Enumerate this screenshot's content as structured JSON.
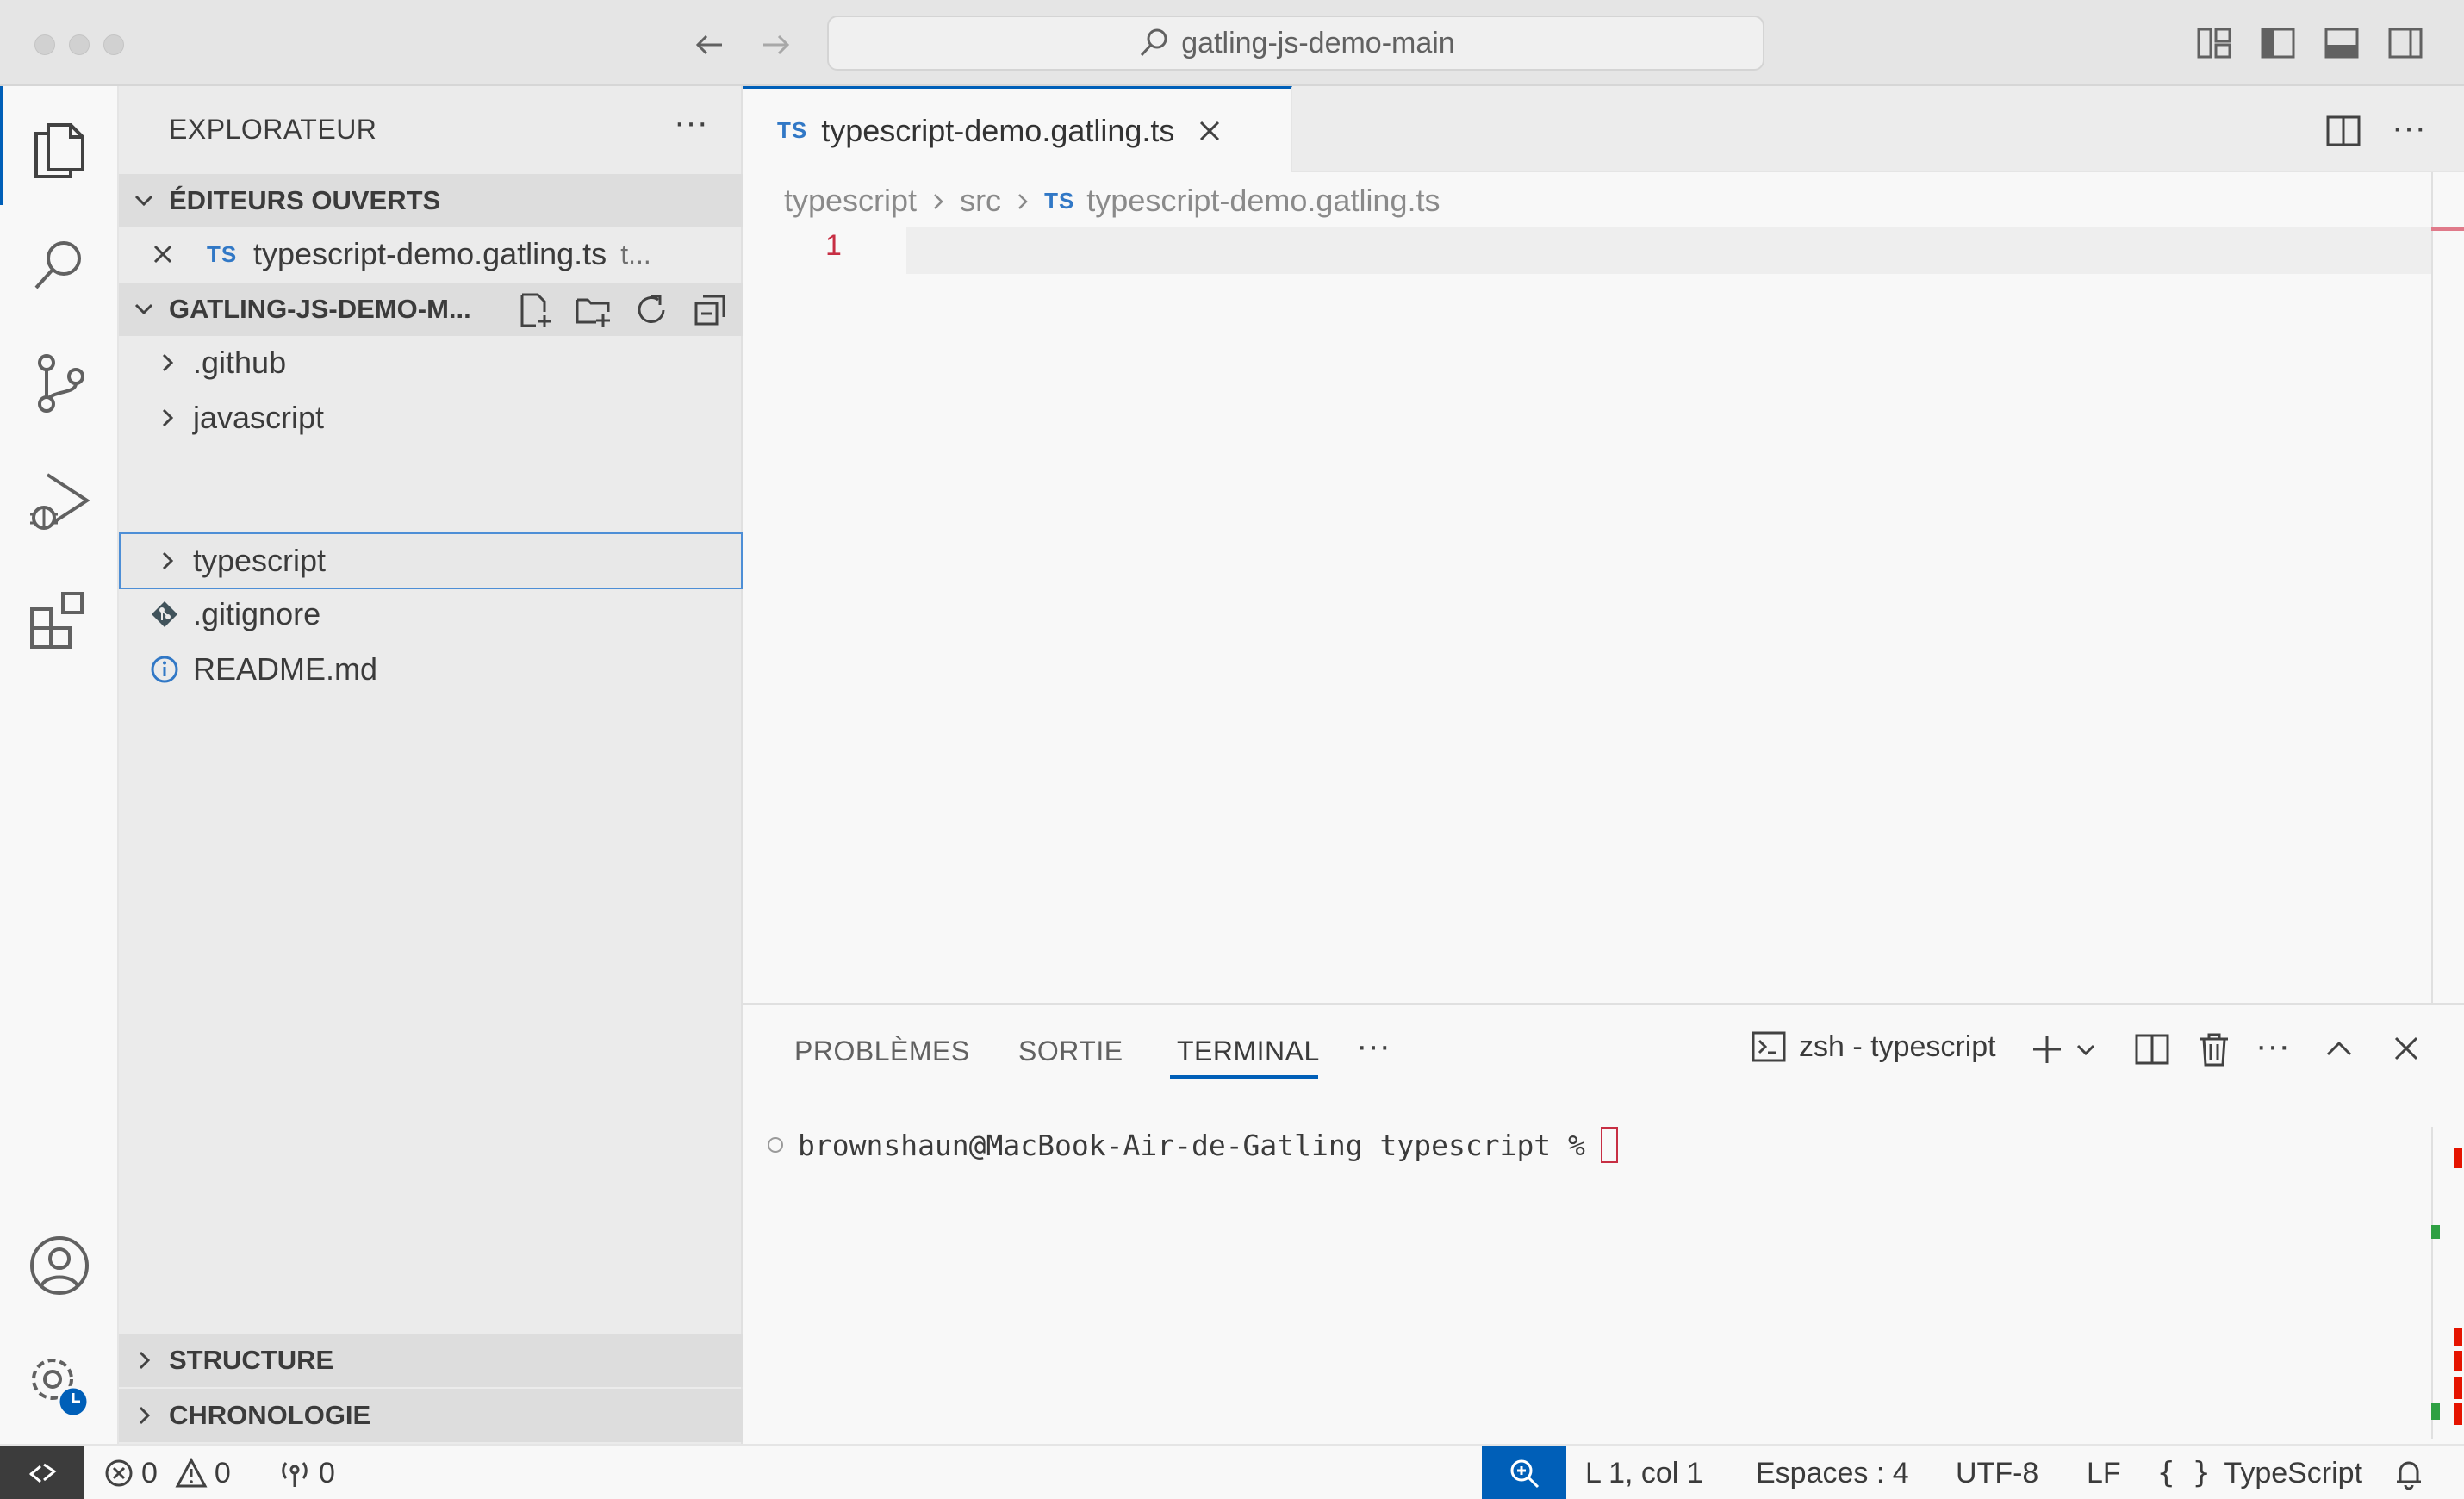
{
  "window": {
    "search_text": "gatling-js-demo-main"
  },
  "sidebar": {
    "title": "EXPLORATEUR",
    "open_editors": {
      "label": "ÉDITEURS OUVERTS",
      "items": [
        {
          "badge": "TS",
          "name": "typescript-demo.gatling.ts",
          "hint": "t..."
        }
      ]
    },
    "project": {
      "label": "GATLING-JS-DEMO-M...",
      "items": [
        {
          "name": ".github",
          "kind": "folder"
        },
        {
          "name": "javascript",
          "kind": "folder"
        },
        {
          "name": "typescript",
          "kind": "folder",
          "selected": true
        },
        {
          "name": ".gitignore",
          "kind": "git-file"
        },
        {
          "name": "README.md",
          "kind": "info-file"
        }
      ]
    },
    "structure_label": "STRUCTURE",
    "timeline_label": "CHRONOLOGIE"
  },
  "editor": {
    "tab": {
      "badge": "TS",
      "label": "typescript-demo.gatling.ts"
    },
    "breadcrumb": [
      "typescript",
      "src",
      "typescript-demo.gatling.ts"
    ],
    "breadcrumb_badge": "TS",
    "line_number": "1"
  },
  "panel": {
    "tabs": [
      "PROBLÈMES",
      "SORTIE",
      "TERMINAL"
    ],
    "active_tab": "TERMINAL",
    "terminal_name": "zsh - typescript",
    "prompt": "brownshaun@MacBook-Air-de-Gatling typescript %"
  },
  "statusbar": {
    "errors": "0",
    "warnings": "0",
    "ports": "0",
    "position": "L 1, col 1",
    "indent": "Espaces : 4",
    "encoding": "UTF-8",
    "eol": "LF",
    "language": "TypeScript"
  },
  "colors": {
    "accent": "#005fb8",
    "ts": "#3178c6",
    "error": "#c72e43"
  }
}
